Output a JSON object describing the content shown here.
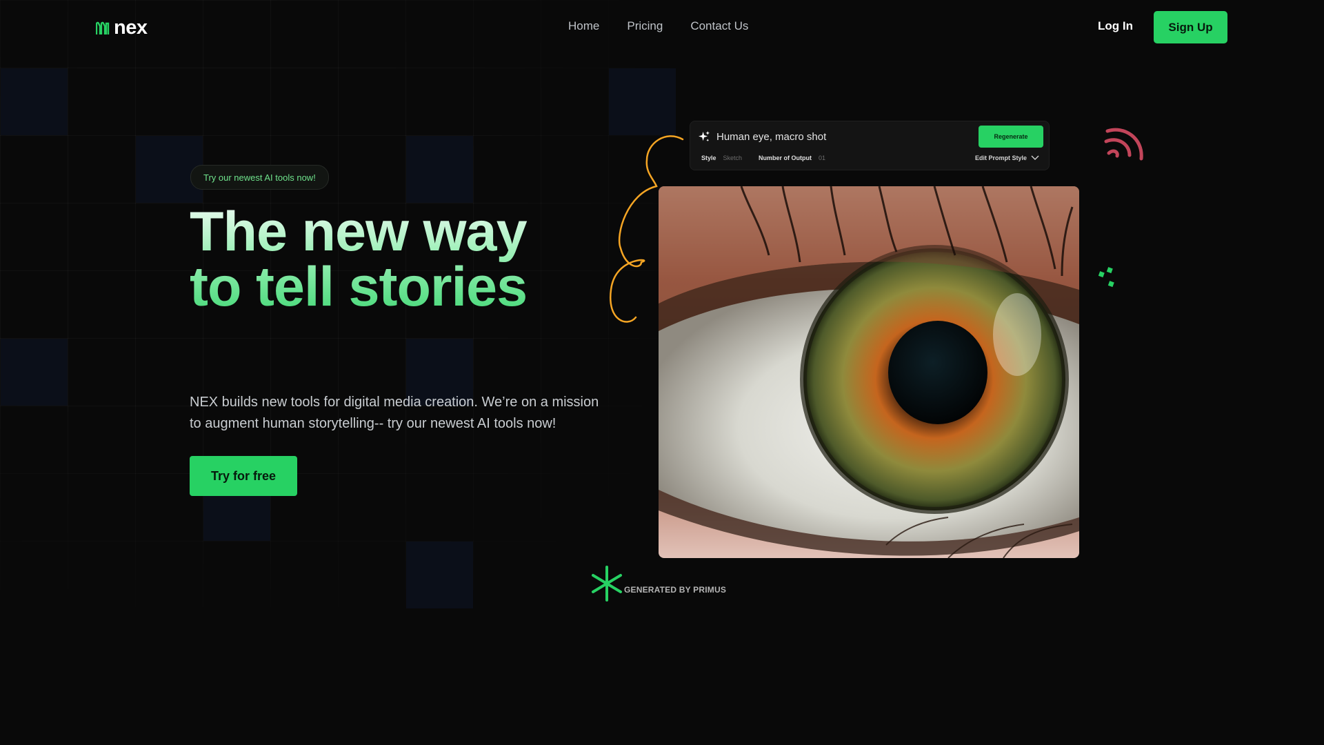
{
  "brand": {
    "name": "nex"
  },
  "nav": {
    "items": [
      "Home",
      "Pricing",
      "Contact Us"
    ]
  },
  "auth": {
    "login": "Log In",
    "signup": "Sign Up"
  },
  "hero": {
    "badge": "Try our newest AI tools now!",
    "headline": "The new way to tell stories",
    "description": "NEX builds new tools for digital media creation. We’re on a mission to augment human storytelling-- try our newest AI tools now!",
    "cta": "Try for free"
  },
  "prompt_card": {
    "prompt": "Human eye, macro shot",
    "regenerate": "Regenerate",
    "style_label": "Style",
    "style_value": "Sketch",
    "outputs_label": "Number of Output",
    "outputs_value": "01",
    "edit_style": "Edit Prompt Style"
  },
  "generated_by": "GENERATED BY PRIMUS",
  "colors": {
    "accent": "#27d163",
    "background": "#090909",
    "squiggle": "#f5a524",
    "signal": "#c2455a"
  }
}
